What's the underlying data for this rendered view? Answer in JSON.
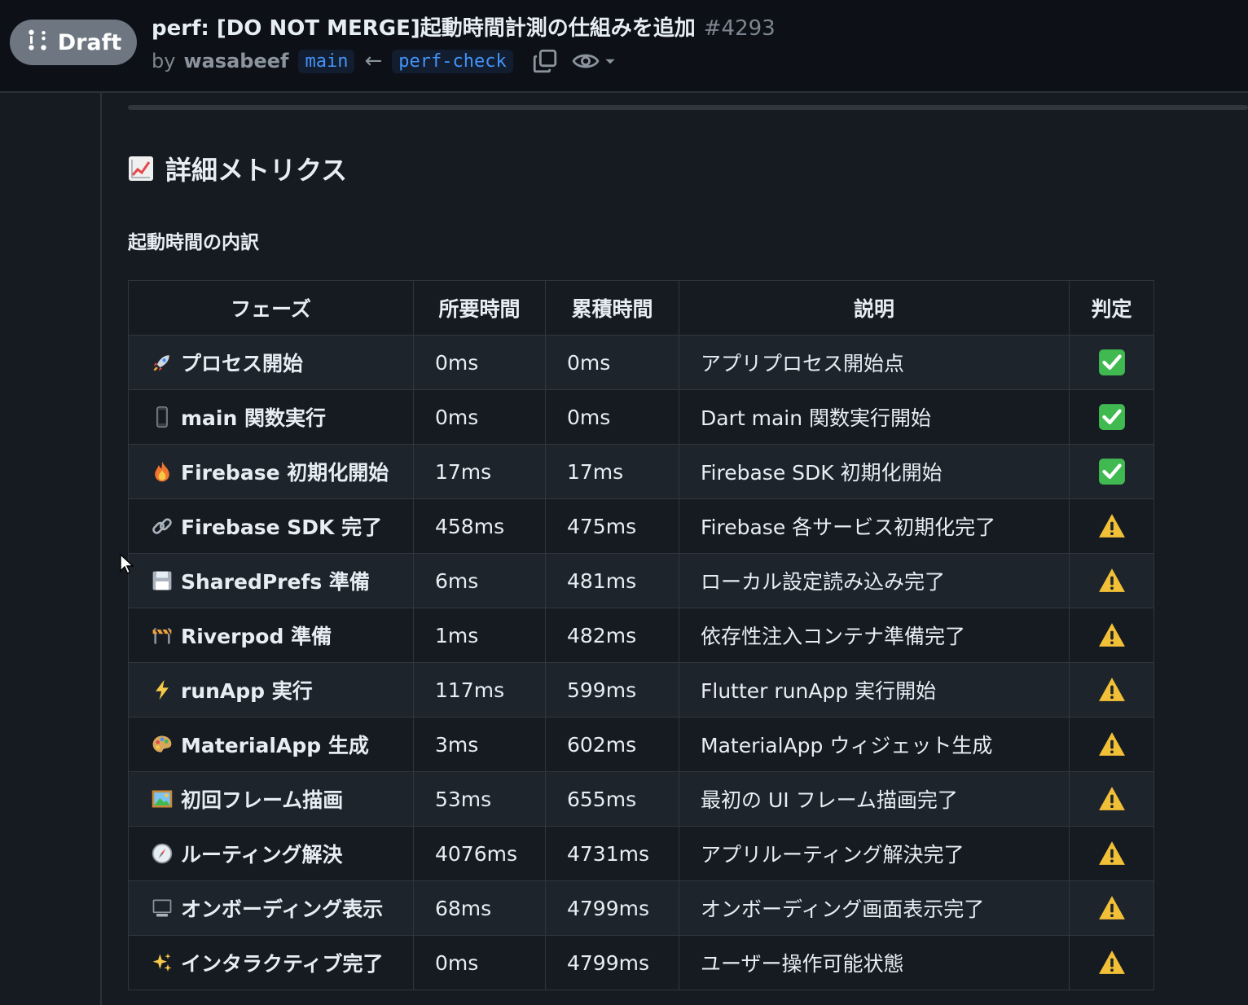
{
  "header": {
    "draft_label": "Draft",
    "title": "perf: [DO NOT MERGE]起動時間計測の仕組みを追加",
    "number": "#4293",
    "by_label": "by",
    "author": "wasabeef",
    "base_branch": "main",
    "arrow": "←",
    "head_branch": "perf-check",
    "icons": [
      "git-pull-request-draft-icon",
      "copy-icon",
      "eye-icon",
      "chevron-down-icon"
    ]
  },
  "content": {
    "section_title": "詳細メトリクス",
    "section_icon": "chart-increasing-icon",
    "subtitle": "起動時間の内訳",
    "table": {
      "headers": [
        "フェーズ",
        "所要時間",
        "累積時間",
        "説明",
        "判定"
      ],
      "rows": [
        {
          "icon": "rocket-icon",
          "phase": "プロセス開始",
          "required": "0ms",
          "cumulative": "0ms",
          "description": "アプリプロセス開始点",
          "judgement": "check-mark-icon"
        },
        {
          "icon": "mobile-phone-icon",
          "phase": "main 関数実行",
          "required": "0ms",
          "cumulative": "0ms",
          "description": "Dart main 関数実行開始",
          "judgement": "check-mark-icon"
        },
        {
          "icon": "fire-icon",
          "phase": "Firebase 初期化開始",
          "required": "17ms",
          "cumulative": "17ms",
          "description": "Firebase SDK 初期化開始",
          "judgement": "check-mark-icon"
        },
        {
          "icon": "link-icon",
          "phase": "Firebase SDK 完了",
          "required": "458ms",
          "cumulative": "475ms",
          "description": "Firebase 各サービス初期化完了",
          "judgement": "warning-icon"
        },
        {
          "icon": "floppy-disk-icon",
          "phase": "SharedPrefs 準備",
          "required": "6ms",
          "cumulative": "481ms",
          "description": "ローカル設定読み込み完了",
          "judgement": "warning-icon"
        },
        {
          "icon": "construction-icon",
          "phase": "Riverpod 準備",
          "required": "1ms",
          "cumulative": "482ms",
          "description": "依存性注入コンテナ準備完了",
          "judgement": "warning-icon"
        },
        {
          "icon": "lightning-icon",
          "phase": "runApp 実行",
          "required": "117ms",
          "cumulative": "599ms",
          "description": "Flutter runApp 実行開始",
          "judgement": "warning-icon"
        },
        {
          "icon": "palette-icon",
          "phase": "MaterialApp 生成",
          "required": "3ms",
          "cumulative": "602ms",
          "description": "MaterialApp ウィジェット生成",
          "judgement": "warning-icon"
        },
        {
          "icon": "framed-picture-icon",
          "phase": "初回フレーム描画",
          "required": "53ms",
          "cumulative": "655ms",
          "description": "最初の UI フレーム描画完了",
          "judgement": "warning-icon"
        },
        {
          "icon": "compass-icon",
          "phase": "ルーティング解決",
          "required": "4076ms",
          "cumulative": "4731ms",
          "description": "アプリルーティング解決完了",
          "judgement": "warning-icon"
        },
        {
          "icon": "monitor-icon",
          "phase": "オンボーディング表示",
          "required": "68ms",
          "cumulative": "4799ms",
          "description": "オンボーディング画面表示完了",
          "judgement": "warning-icon"
        },
        {
          "icon": "sparkles-icon",
          "phase": "インタラクティブ完了",
          "required": "0ms",
          "cumulative": "4799ms",
          "description": "ユーザー操作可能状態",
          "judgement": "warning-icon"
        }
      ]
    }
  },
  "colors": {
    "background": "#161b22",
    "header_bg": "#0d1117",
    "text": "#e6edf3",
    "muted": "#7d8590",
    "link": "#4493f8",
    "check": "#3fb950",
    "warning": "#f2c037"
  }
}
